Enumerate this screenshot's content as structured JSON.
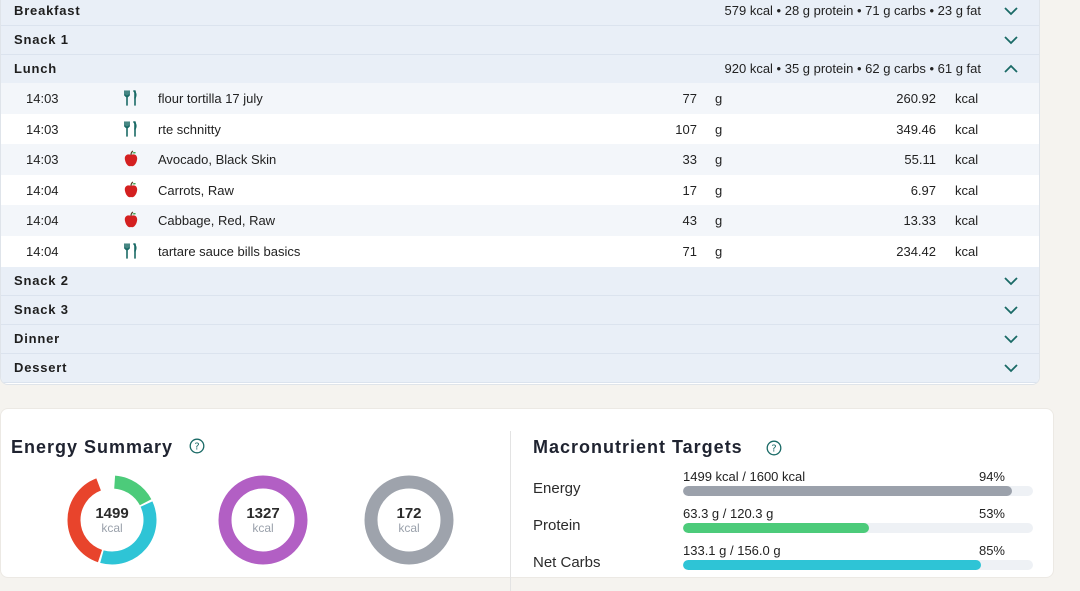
{
  "colors": {
    "header_bg": "#e9eff7",
    "row_alt": "#f3f6fa",
    "chevron": "#1a6a66",
    "energy_bar": "#9ba1ab",
    "protein": "#4ccb7a",
    "carbs": "#2ec4d6",
    "fat": "#e8442c",
    "ring_burned": "#b25fc4",
    "ring_remaining": "#9ea3ac"
  },
  "meals": {
    "breakfast": {
      "name": "Breakfast",
      "summary": "579 kcal • 28 g protein • 71 g carbs • 23 g fat",
      "expanded": false
    },
    "snack1": {
      "name": "Snack 1",
      "summary": "",
      "expanded": false
    },
    "lunch": {
      "name": "Lunch",
      "summary": "920 kcal • 35 g protein • 62 g carbs • 61 g fat",
      "expanded": true,
      "items": [
        {
          "time": "14:03",
          "icon": "utensils-icon",
          "name": "flour tortilla 17 july",
          "amount": "77",
          "unit": "g",
          "kcal": "260.92",
          "kunit": "kcal"
        },
        {
          "time": "14:03",
          "icon": "utensils-icon",
          "name": "rte schnitty",
          "amount": "107",
          "unit": "g",
          "kcal": "349.46",
          "kunit": "kcal"
        },
        {
          "time": "14:03",
          "icon": "apple-icon",
          "name": "Avocado, Black Skin",
          "amount": "33",
          "unit": "g",
          "kcal": "55.11",
          "kunit": "kcal"
        },
        {
          "time": "14:04",
          "icon": "apple-icon",
          "name": "Carrots, Raw",
          "amount": "17",
          "unit": "g",
          "kcal": "6.97",
          "kunit": "kcal"
        },
        {
          "time": "14:04",
          "icon": "apple-icon",
          "name": "Cabbage, Red, Raw",
          "amount": "43",
          "unit": "g",
          "kcal": "13.33",
          "kunit": "kcal"
        },
        {
          "time": "14:04",
          "icon": "utensils-icon",
          "name": "tartare sauce bills basics",
          "amount": "71",
          "unit": "g",
          "kcal": "234.42",
          "kunit": "kcal"
        }
      ]
    },
    "snack2": {
      "name": "Snack 2",
      "summary": "",
      "expanded": false
    },
    "snack3": {
      "name": "Snack 3",
      "summary": "",
      "expanded": false
    },
    "dinner": {
      "name": "Dinner",
      "summary": "",
      "expanded": false
    },
    "dessert": {
      "name": "Dessert",
      "summary": "",
      "expanded": false
    }
  },
  "energy_summary": {
    "title": "Energy Summary",
    "rings": [
      {
        "value": "1499",
        "unit": "kcal",
        "segments": [
          {
            "part": "fat",
            "fraction": 0.4,
            "color": "#e8442c"
          },
          {
            "part": "carbs",
            "fraction": 0.37,
            "color": "#2ec4d6"
          },
          {
            "part": "protein",
            "fraction": 0.17,
            "color": "#4ccb7a"
          }
        ]
      },
      {
        "value": "1327",
        "unit": "kcal",
        "segments": [
          {
            "part": "burned",
            "fraction": 1.0,
            "color": "#b25fc4"
          }
        ]
      },
      {
        "value": "172",
        "unit": "kcal",
        "segments": [
          {
            "part": "remaining",
            "fraction": 1.0,
            "color": "#9ea3ac"
          }
        ]
      }
    ]
  },
  "macronutrient_targets": {
    "title": "Macronutrient Targets",
    "rows": [
      {
        "label": "Energy",
        "text": "1499 kcal / 1600 kcal",
        "percent": "94%",
        "fraction": 0.94,
        "color": "#9ba1ab"
      },
      {
        "label": "Protein",
        "text": "63.3 g / 120.3 g",
        "percent": "53%",
        "fraction": 0.53,
        "color": "#4ccb7a"
      },
      {
        "label": "Net Carbs",
        "text": "133.1 g / 156.0 g",
        "percent": "85%",
        "fraction": 0.85,
        "color": "#2ec4d6"
      }
    ]
  }
}
